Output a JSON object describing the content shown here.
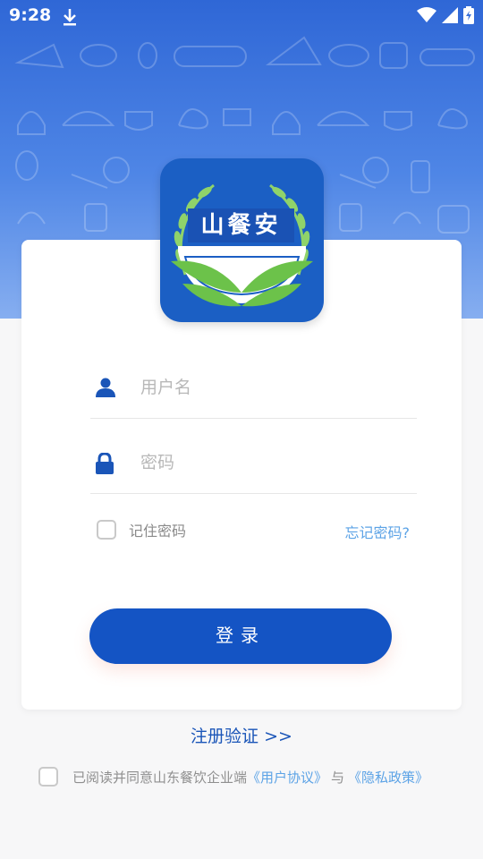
{
  "status_bar": {
    "time": "9:28",
    "icons": [
      "download-icon",
      "wifi-icon",
      "signal-icon",
      "battery-icon"
    ]
  },
  "logo": {
    "brand_text": "山餐安",
    "colors": {
      "background": "#1b5fc4",
      "wheat": "#6cc24a",
      "bowl": "#ffffff"
    }
  },
  "form": {
    "username": {
      "placeholder": "用户名",
      "value": "",
      "icon": "user-icon"
    },
    "password": {
      "placeholder": "密码",
      "value": "",
      "icon": "lock-icon"
    },
    "remember_label": "记住密码",
    "remember_checked": false,
    "forgot_label": "忘记密码?",
    "login_label": "登录"
  },
  "register_link": "注册验证 >>",
  "agreement": {
    "checked": false,
    "prefix": "已阅读并同意山东餐饮企业端",
    "user_agreement": "《用户协议》",
    "connector": "与",
    "privacy_policy": "《隐私政策》"
  },
  "colors": {
    "primary": "#1454c4",
    "link": "#5ca3e6",
    "hero_top": "#2f67d6",
    "hero_bottom": "#86aef0"
  }
}
